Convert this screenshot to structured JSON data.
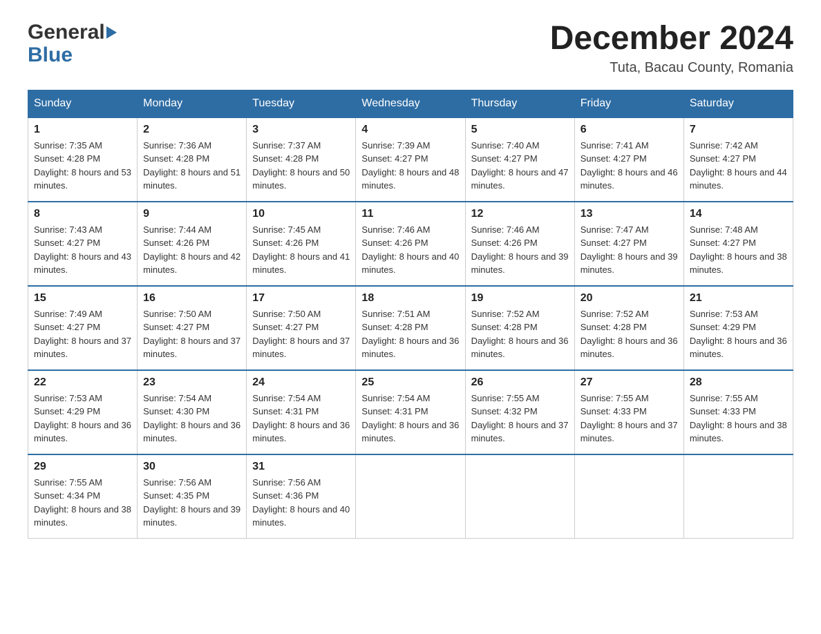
{
  "header": {
    "logo": {
      "general_text": "General",
      "blue_text": "Blue"
    },
    "title": "December 2024",
    "location": "Tuta, Bacau County, Romania"
  },
  "calendar": {
    "days_of_week": [
      "Sunday",
      "Monday",
      "Tuesday",
      "Wednesday",
      "Thursday",
      "Friday",
      "Saturday"
    ],
    "weeks": [
      {
        "days": [
          {
            "number": "1",
            "sunrise": "7:35 AM",
            "sunset": "4:28 PM",
            "daylight": "8 hours and 53 minutes."
          },
          {
            "number": "2",
            "sunrise": "7:36 AM",
            "sunset": "4:28 PM",
            "daylight": "8 hours and 51 minutes."
          },
          {
            "number": "3",
            "sunrise": "7:37 AM",
            "sunset": "4:28 PM",
            "daylight": "8 hours and 50 minutes."
          },
          {
            "number": "4",
            "sunrise": "7:39 AM",
            "sunset": "4:27 PM",
            "daylight": "8 hours and 48 minutes."
          },
          {
            "number": "5",
            "sunrise": "7:40 AM",
            "sunset": "4:27 PM",
            "daylight": "8 hours and 47 minutes."
          },
          {
            "number": "6",
            "sunrise": "7:41 AM",
            "sunset": "4:27 PM",
            "daylight": "8 hours and 46 minutes."
          },
          {
            "number": "7",
            "sunrise": "7:42 AM",
            "sunset": "4:27 PM",
            "daylight": "8 hours and 44 minutes."
          }
        ]
      },
      {
        "days": [
          {
            "number": "8",
            "sunrise": "7:43 AM",
            "sunset": "4:27 PM",
            "daylight": "8 hours and 43 minutes."
          },
          {
            "number": "9",
            "sunrise": "7:44 AM",
            "sunset": "4:26 PM",
            "daylight": "8 hours and 42 minutes."
          },
          {
            "number": "10",
            "sunrise": "7:45 AM",
            "sunset": "4:26 PM",
            "daylight": "8 hours and 41 minutes."
          },
          {
            "number": "11",
            "sunrise": "7:46 AM",
            "sunset": "4:26 PM",
            "daylight": "8 hours and 40 minutes."
          },
          {
            "number": "12",
            "sunrise": "7:46 AM",
            "sunset": "4:26 PM",
            "daylight": "8 hours and 39 minutes."
          },
          {
            "number": "13",
            "sunrise": "7:47 AM",
            "sunset": "4:27 PM",
            "daylight": "8 hours and 39 minutes."
          },
          {
            "number": "14",
            "sunrise": "7:48 AM",
            "sunset": "4:27 PM",
            "daylight": "8 hours and 38 minutes."
          }
        ]
      },
      {
        "days": [
          {
            "number": "15",
            "sunrise": "7:49 AM",
            "sunset": "4:27 PM",
            "daylight": "8 hours and 37 minutes."
          },
          {
            "number": "16",
            "sunrise": "7:50 AM",
            "sunset": "4:27 PM",
            "daylight": "8 hours and 37 minutes."
          },
          {
            "number": "17",
            "sunrise": "7:50 AM",
            "sunset": "4:27 PM",
            "daylight": "8 hours and 37 minutes."
          },
          {
            "number": "18",
            "sunrise": "7:51 AM",
            "sunset": "4:28 PM",
            "daylight": "8 hours and 36 minutes."
          },
          {
            "number": "19",
            "sunrise": "7:52 AM",
            "sunset": "4:28 PM",
            "daylight": "8 hours and 36 minutes."
          },
          {
            "number": "20",
            "sunrise": "7:52 AM",
            "sunset": "4:28 PM",
            "daylight": "8 hours and 36 minutes."
          },
          {
            "number": "21",
            "sunrise": "7:53 AM",
            "sunset": "4:29 PM",
            "daylight": "8 hours and 36 minutes."
          }
        ]
      },
      {
        "days": [
          {
            "number": "22",
            "sunrise": "7:53 AM",
            "sunset": "4:29 PM",
            "daylight": "8 hours and 36 minutes."
          },
          {
            "number": "23",
            "sunrise": "7:54 AM",
            "sunset": "4:30 PM",
            "daylight": "8 hours and 36 minutes."
          },
          {
            "number": "24",
            "sunrise": "7:54 AM",
            "sunset": "4:31 PM",
            "daylight": "8 hours and 36 minutes."
          },
          {
            "number": "25",
            "sunrise": "7:54 AM",
            "sunset": "4:31 PM",
            "daylight": "8 hours and 36 minutes."
          },
          {
            "number": "26",
            "sunrise": "7:55 AM",
            "sunset": "4:32 PM",
            "daylight": "8 hours and 37 minutes."
          },
          {
            "number": "27",
            "sunrise": "7:55 AM",
            "sunset": "4:33 PM",
            "daylight": "8 hours and 37 minutes."
          },
          {
            "number": "28",
            "sunrise": "7:55 AM",
            "sunset": "4:33 PM",
            "daylight": "8 hours and 38 minutes."
          }
        ]
      },
      {
        "days": [
          {
            "number": "29",
            "sunrise": "7:55 AM",
            "sunset": "4:34 PM",
            "daylight": "8 hours and 38 minutes."
          },
          {
            "number": "30",
            "sunrise": "7:56 AM",
            "sunset": "4:35 PM",
            "daylight": "8 hours and 39 minutes."
          },
          {
            "number": "31",
            "sunrise": "7:56 AM",
            "sunset": "4:36 PM",
            "daylight": "8 hours and 40 minutes."
          },
          null,
          null,
          null,
          null
        ]
      }
    ]
  }
}
